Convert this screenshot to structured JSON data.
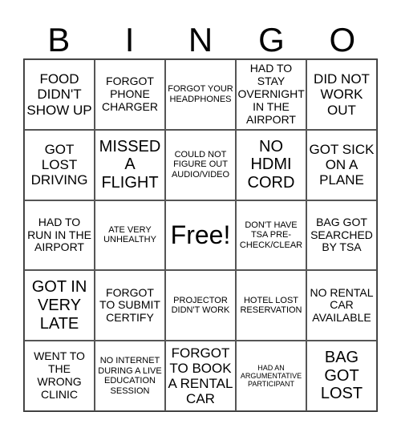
{
  "header": {
    "letters": [
      "B",
      "I",
      "N",
      "G",
      "O"
    ]
  },
  "cells": [
    {
      "text": "FOOD DIDN'T SHOW UP",
      "size": "s-l"
    },
    {
      "text": "FORGOT PHONE CHARGER",
      "size": "s-m"
    },
    {
      "text": "FORGOT YOUR HEADPHONES",
      "size": "s-s"
    },
    {
      "text": "HAD TO STAY OVERNIGHT IN THE AIRPORT",
      "size": "s-m"
    },
    {
      "text": "DID NOT WORK OUT",
      "size": "s-l"
    },
    {
      "text": "GOT LOST DRIVING",
      "size": "s-l"
    },
    {
      "text": "MISSED A FLIGHT",
      "size": "s-xl"
    },
    {
      "text": "COULD NOT FIGURE OUT AUDIO/VIDEO",
      "size": "s-s"
    },
    {
      "text": "NO HDMI CORD",
      "size": "s-xl"
    },
    {
      "text": "GOT SICK ON A PLANE",
      "size": "s-l"
    },
    {
      "text": "HAD TO RUN IN THE AIRPORT",
      "size": "s-m"
    },
    {
      "text": "ATE VERY UNHEALTHY",
      "size": "s-s"
    },
    {
      "text": "Free!",
      "size": "s-xxl"
    },
    {
      "text": "DON'T HAVE TSA PRE-CHECK/CLEAR",
      "size": "s-s"
    },
    {
      "text": "BAG GOT SEARCHED BY TSA",
      "size": "s-m"
    },
    {
      "text": "GOT IN VERY LATE",
      "size": "s-xl"
    },
    {
      "text": "FORGOT TO SUBMIT CERTIFY",
      "size": "s-m"
    },
    {
      "text": "PROJECTOR DIDN'T WORK",
      "size": "s-s"
    },
    {
      "text": "HOTEL LOST RESERVATION",
      "size": "s-s"
    },
    {
      "text": "NO RENTAL CAR AVAILABLE",
      "size": "s-m"
    },
    {
      "text": "WENT TO THE WRONG CLINIC",
      "size": "s-m"
    },
    {
      "text": "NO INTERNET DURING A LIVE EDUCATION SESSION",
      "size": "s-s"
    },
    {
      "text": "FORGOT TO BOOK A RENTAL CAR",
      "size": "s-l"
    },
    {
      "text": "HAD AN ARGUMENTATIVE PARTICIPANT",
      "size": "s-xs"
    },
    {
      "text": "BAG GOT LOST",
      "size": "s-xl"
    }
  ]
}
